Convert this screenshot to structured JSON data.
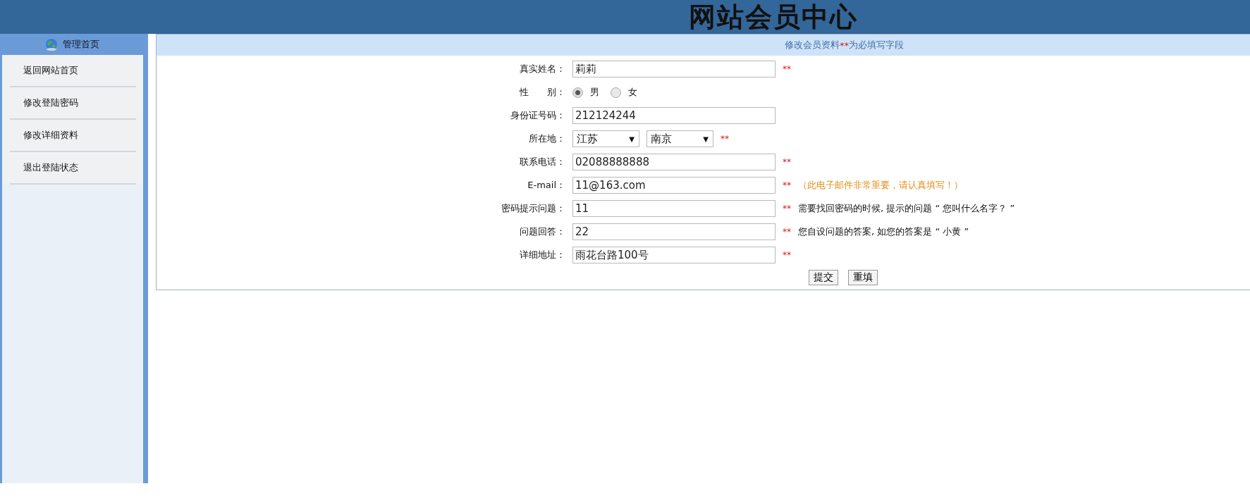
{
  "header": {
    "title": "网站会员中心"
  },
  "sidebar": {
    "title": "管理首页",
    "items": [
      {
        "label": "返回网站首页"
      },
      {
        "label": "修改登陆密码"
      },
      {
        "label": "修改详细资料"
      },
      {
        "label": "退出登陆状态"
      }
    ]
  },
  "panel": {
    "heading": {
      "before": "修改会员资料",
      "mark": "**",
      "after": "为必填写字段"
    }
  },
  "form": {
    "fields": [
      {
        "kind": "text",
        "label": "真实姓名：",
        "value": "莉莉",
        "required_mark": "**"
      },
      {
        "kind": "radio",
        "label": "性　　别：",
        "options": [
          {
            "label": "男",
            "selected": true
          },
          {
            "label": "女",
            "selected": false
          }
        ]
      },
      {
        "kind": "text",
        "label": "身份证号码：",
        "value": "212124244"
      },
      {
        "kind": "selects",
        "label": "所在地：",
        "selects": [
          {
            "value": "江苏",
            "caret": "▼"
          },
          {
            "value": "南京",
            "caret": "▼"
          }
        ],
        "required_mark": "**"
      },
      {
        "kind": "text",
        "label": "联系电话：",
        "value": "02088888888",
        "required_mark": "**"
      },
      {
        "kind": "text",
        "label": "E-mail：",
        "value": "11@163.com",
        "required_mark": "**",
        "hint": {
          "kind": "warning",
          "text": "（此电子邮件非常重要，请认真填写！）"
        }
      },
      {
        "kind": "text",
        "label": "密码提示问题：",
        "value": "11",
        "required_mark": "**",
        "hint": {
          "kind": "plain",
          "text": "需要找回密码的时候, 提示的问题 “ 您叫什么名字？ ”"
        }
      },
      {
        "kind": "text",
        "label": "问题回答：",
        "value": "22",
        "required_mark": "**",
        "hint": {
          "kind": "plain",
          "text": "您自设问题的答案, 如您的答案是 “ 小黄 ”"
        }
      },
      {
        "kind": "text",
        "label": "详细地址：",
        "value": "雨花台路100号",
        "required_mark": "**"
      }
    ],
    "buttons": [
      "提交",
      "重填"
    ]
  }
}
